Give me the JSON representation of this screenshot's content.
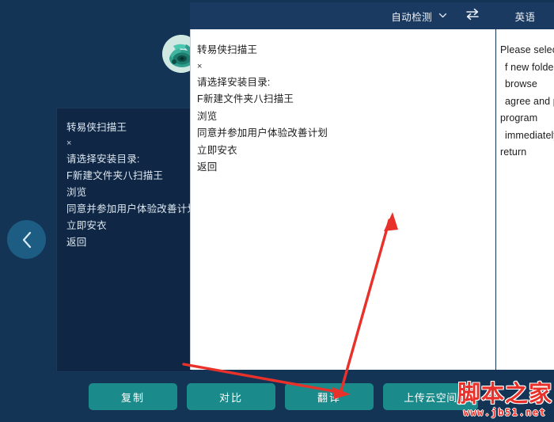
{
  "window": {
    "background_color": "#143456",
    "panel_color": "#0f2744",
    "header_color": "#1b3a61",
    "accent_color": "#1b8a8a",
    "annotation_color": "#e8312a"
  },
  "collapse_button": {
    "icon": "chevron-left-icon",
    "label": ""
  },
  "app_logo": {
    "icon": "scanner-app-icon",
    "name": "转易侠扫描王"
  },
  "language_bar": {
    "source_language": "自动检测",
    "source_dropdown_icon": "chevron-down-icon",
    "swap_icon": "swap-arrows-icon",
    "target_language": "英语"
  },
  "source_card": {
    "title": "转易侠扫描王",
    "lines": [
      "转易侠扫描王",
      "×",
      "请选择安装目录:",
      "F新建文件夹八扫描王",
      "浏览",
      "同意并参加用户体验改善计划",
      "立即安衣",
      "返回"
    ]
  },
  "ocr_panel": {
    "lines": [
      "转易侠扫描王",
      "×",
      "请选择安装目录:",
      "F新建文件夹八扫描王",
      "浏览",
      "同意并参加用户体验改善计划",
      "立即安衣",
      "返回"
    ]
  },
  "translation_panel": {
    "lines": [
      "Please selec",
      "f new folde",
      "browse",
      "agree and p",
      "program",
      "immediately",
      "return"
    ]
  },
  "action_bar": {
    "buttons": [
      {
        "label": "复制",
        "name": "copy-button"
      },
      {
        "label": "对比",
        "name": "compare-button"
      },
      {
        "label": "翻译",
        "name": "translate-button"
      },
      {
        "label": "上传云空间",
        "name": "upload-cloud-button"
      }
    ]
  },
  "watermark": {
    "main": "脚本之家",
    "sub": "www.jb51.net"
  }
}
